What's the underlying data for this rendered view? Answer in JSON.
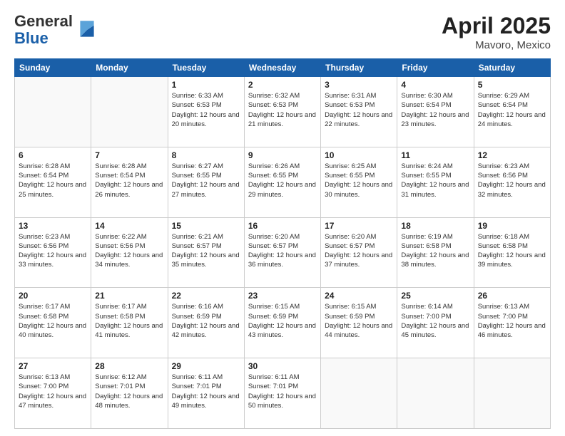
{
  "header": {
    "logo_general": "General",
    "logo_blue": "Blue",
    "title": "April 2025",
    "location": "Mavoro, Mexico"
  },
  "days_of_week": [
    "Sunday",
    "Monday",
    "Tuesday",
    "Wednesday",
    "Thursday",
    "Friday",
    "Saturday"
  ],
  "weeks": [
    [
      {
        "day": "",
        "info": ""
      },
      {
        "day": "",
        "info": ""
      },
      {
        "day": "1",
        "info": "Sunrise: 6:33 AM\nSunset: 6:53 PM\nDaylight: 12 hours and 20 minutes."
      },
      {
        "day": "2",
        "info": "Sunrise: 6:32 AM\nSunset: 6:53 PM\nDaylight: 12 hours and 21 minutes."
      },
      {
        "day": "3",
        "info": "Sunrise: 6:31 AM\nSunset: 6:53 PM\nDaylight: 12 hours and 22 minutes."
      },
      {
        "day": "4",
        "info": "Sunrise: 6:30 AM\nSunset: 6:54 PM\nDaylight: 12 hours and 23 minutes."
      },
      {
        "day": "5",
        "info": "Sunrise: 6:29 AM\nSunset: 6:54 PM\nDaylight: 12 hours and 24 minutes."
      }
    ],
    [
      {
        "day": "6",
        "info": "Sunrise: 6:28 AM\nSunset: 6:54 PM\nDaylight: 12 hours and 25 minutes."
      },
      {
        "day": "7",
        "info": "Sunrise: 6:28 AM\nSunset: 6:54 PM\nDaylight: 12 hours and 26 minutes."
      },
      {
        "day": "8",
        "info": "Sunrise: 6:27 AM\nSunset: 6:55 PM\nDaylight: 12 hours and 27 minutes."
      },
      {
        "day": "9",
        "info": "Sunrise: 6:26 AM\nSunset: 6:55 PM\nDaylight: 12 hours and 29 minutes."
      },
      {
        "day": "10",
        "info": "Sunrise: 6:25 AM\nSunset: 6:55 PM\nDaylight: 12 hours and 30 minutes."
      },
      {
        "day": "11",
        "info": "Sunrise: 6:24 AM\nSunset: 6:55 PM\nDaylight: 12 hours and 31 minutes."
      },
      {
        "day": "12",
        "info": "Sunrise: 6:23 AM\nSunset: 6:56 PM\nDaylight: 12 hours and 32 minutes."
      }
    ],
    [
      {
        "day": "13",
        "info": "Sunrise: 6:23 AM\nSunset: 6:56 PM\nDaylight: 12 hours and 33 minutes."
      },
      {
        "day": "14",
        "info": "Sunrise: 6:22 AM\nSunset: 6:56 PM\nDaylight: 12 hours and 34 minutes."
      },
      {
        "day": "15",
        "info": "Sunrise: 6:21 AM\nSunset: 6:57 PM\nDaylight: 12 hours and 35 minutes."
      },
      {
        "day": "16",
        "info": "Sunrise: 6:20 AM\nSunset: 6:57 PM\nDaylight: 12 hours and 36 minutes."
      },
      {
        "day": "17",
        "info": "Sunrise: 6:20 AM\nSunset: 6:57 PM\nDaylight: 12 hours and 37 minutes."
      },
      {
        "day": "18",
        "info": "Sunrise: 6:19 AM\nSunset: 6:58 PM\nDaylight: 12 hours and 38 minutes."
      },
      {
        "day": "19",
        "info": "Sunrise: 6:18 AM\nSunset: 6:58 PM\nDaylight: 12 hours and 39 minutes."
      }
    ],
    [
      {
        "day": "20",
        "info": "Sunrise: 6:17 AM\nSunset: 6:58 PM\nDaylight: 12 hours and 40 minutes."
      },
      {
        "day": "21",
        "info": "Sunrise: 6:17 AM\nSunset: 6:58 PM\nDaylight: 12 hours and 41 minutes."
      },
      {
        "day": "22",
        "info": "Sunrise: 6:16 AM\nSunset: 6:59 PM\nDaylight: 12 hours and 42 minutes."
      },
      {
        "day": "23",
        "info": "Sunrise: 6:15 AM\nSunset: 6:59 PM\nDaylight: 12 hours and 43 minutes."
      },
      {
        "day": "24",
        "info": "Sunrise: 6:15 AM\nSunset: 6:59 PM\nDaylight: 12 hours and 44 minutes."
      },
      {
        "day": "25",
        "info": "Sunrise: 6:14 AM\nSunset: 7:00 PM\nDaylight: 12 hours and 45 minutes."
      },
      {
        "day": "26",
        "info": "Sunrise: 6:13 AM\nSunset: 7:00 PM\nDaylight: 12 hours and 46 minutes."
      }
    ],
    [
      {
        "day": "27",
        "info": "Sunrise: 6:13 AM\nSunset: 7:00 PM\nDaylight: 12 hours and 47 minutes."
      },
      {
        "day": "28",
        "info": "Sunrise: 6:12 AM\nSunset: 7:01 PM\nDaylight: 12 hours and 48 minutes."
      },
      {
        "day": "29",
        "info": "Sunrise: 6:11 AM\nSunset: 7:01 PM\nDaylight: 12 hours and 49 minutes."
      },
      {
        "day": "30",
        "info": "Sunrise: 6:11 AM\nSunset: 7:01 PM\nDaylight: 12 hours and 50 minutes."
      },
      {
        "day": "",
        "info": ""
      },
      {
        "day": "",
        "info": ""
      },
      {
        "day": "",
        "info": ""
      }
    ]
  ]
}
